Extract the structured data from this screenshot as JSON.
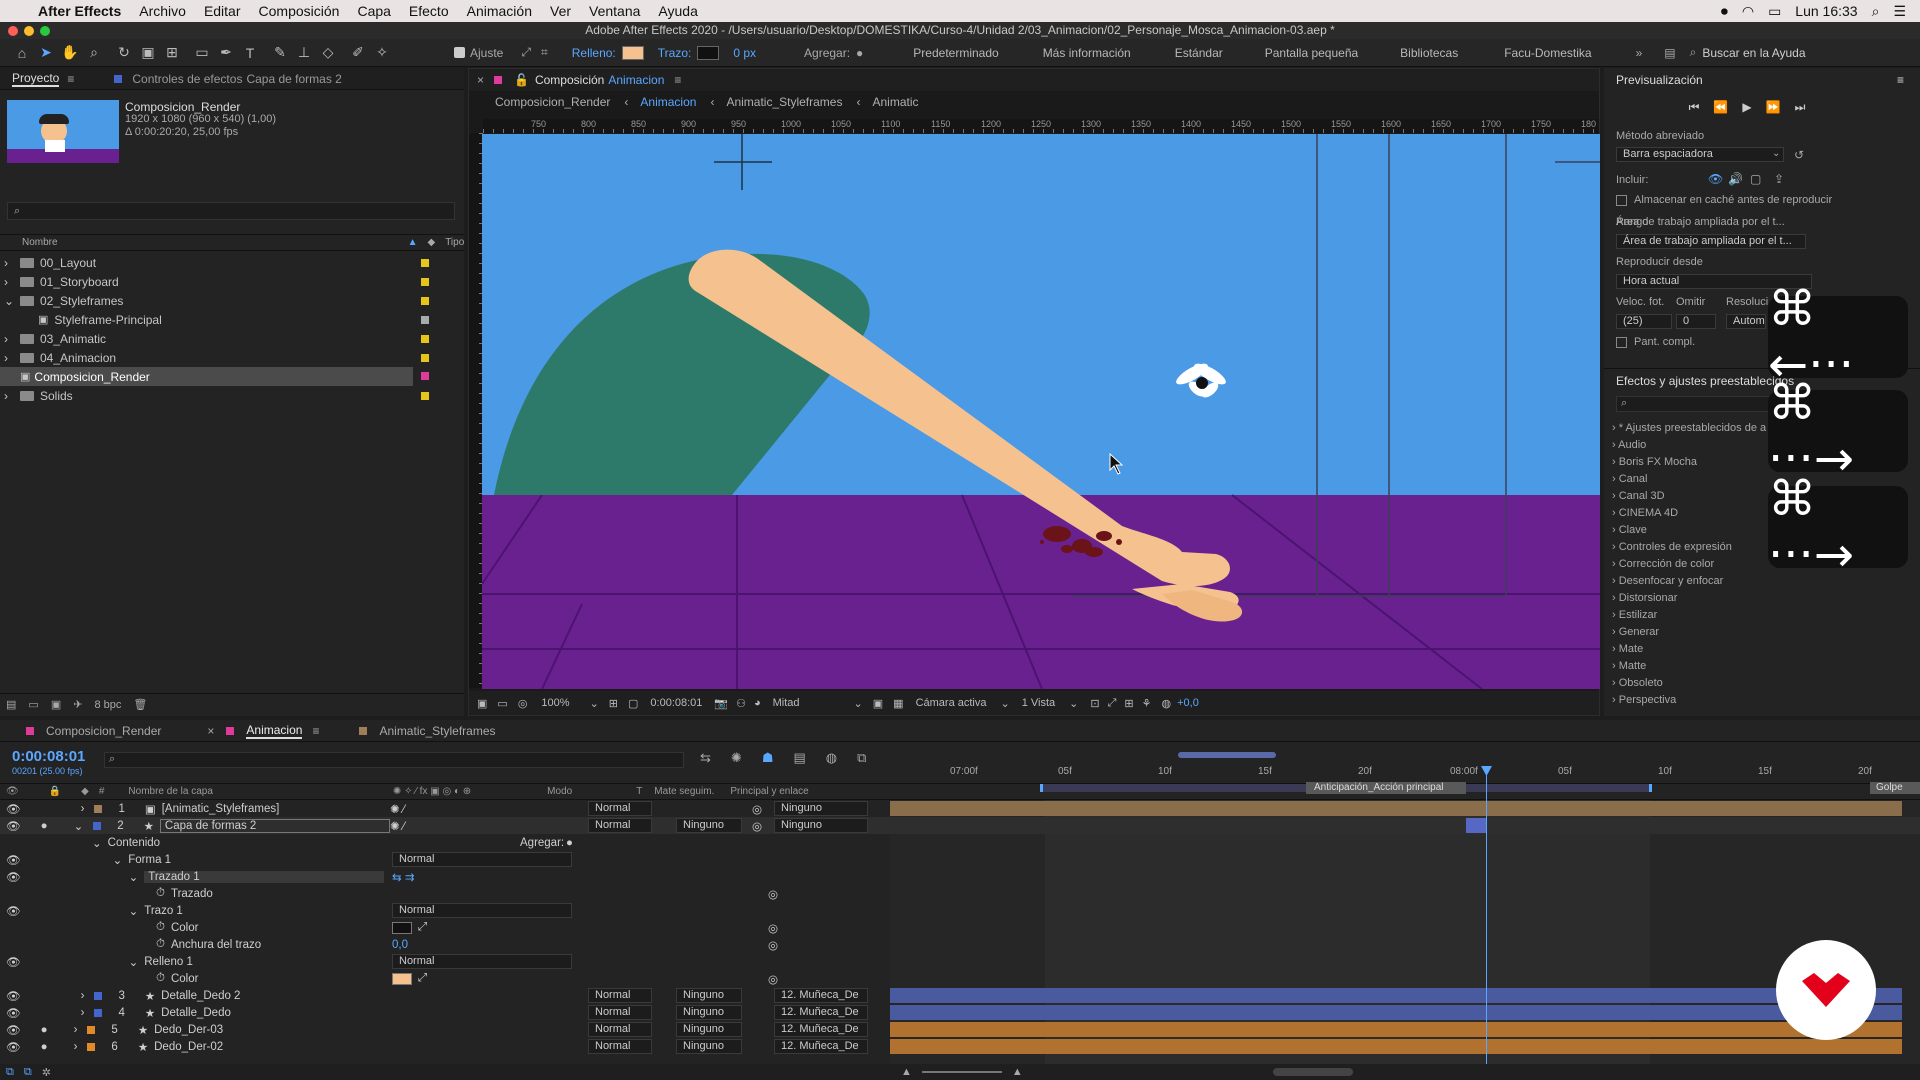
{
  "menubar": {
    "app": "After Effects",
    "items": [
      "Archivo",
      "Editar",
      "Composición",
      "Capa",
      "Efecto",
      "Animación",
      "Ver",
      "Ventana",
      "Ayuda"
    ],
    "clock": "Lun 16:33"
  },
  "window_title": "Adobe After Effects 2020 - /Users/usuario/Desktop/DOMESTIKA/Curso-4/Unidad 2/03_Animacion/02_Personaje_Mosca_Animacion-03.aep *",
  "toolbar": {
    "ajuste": "Ajuste",
    "relleno": "Relleno:",
    "trazo": "Trazo:",
    "trazo_px": "0 px",
    "agregar": "Agregar:",
    "workspaces": [
      "Predeterminado",
      "Más información",
      "Estándar",
      "Pantalla pequeña",
      "Bibliotecas",
      "Facu-Domestika"
    ],
    "help_placeholder": "Buscar en la Ayuda"
  },
  "project": {
    "tab": "Proyecto",
    "effects_tab": "Controles de efectos",
    "effects_layer": "Capa de formas 2",
    "comp_name": "Composicion_Render",
    "comp_info1": "1920 x 1080  (960 x 540) (1,00)",
    "comp_info2": "Δ 0:00:20:20, 25,00 fps",
    "col_name": "Nombre",
    "col_type": "Tipo",
    "bpc": "8 bpc",
    "items": [
      {
        "name": "00_Layout",
        "kind": "folder"
      },
      {
        "name": "01_Storyboard",
        "kind": "folder"
      },
      {
        "name": "02_Styleframes",
        "kind": "folder"
      },
      {
        "name": "Styleframe-Principal",
        "kind": "comp"
      },
      {
        "name": "03_Animatic",
        "kind": "folder"
      },
      {
        "name": "04_Animacion",
        "kind": "folder"
      },
      {
        "name": "Composicion_Render",
        "kind": "comp"
      },
      {
        "name": "Solids",
        "kind": "folder"
      }
    ]
  },
  "viewer": {
    "tab_prefix": "Composición",
    "tab_name": "Animacion",
    "breadcrumbs": [
      "Composicion_Render",
      "Animacion",
      "Animatic_Styleframes",
      "Animatic"
    ],
    "ruler": [
      "750",
      "800",
      "850",
      "900",
      "950",
      "1000",
      "1050",
      "1100",
      "1150",
      "1200",
      "1250",
      "1300",
      "1350",
      "1400",
      "1450",
      "1500",
      "1550",
      "1600",
      "1650",
      "1700",
      "1750",
      "180"
    ],
    "zoom": "100%",
    "time": "0:00:08:01",
    "resolution": "Mitad",
    "camera": "Cámara activa",
    "views": "1 Vista",
    "exposure": "+0,0"
  },
  "preview": {
    "title": "Previsualización",
    "metodo_label": "Método abreviado",
    "metodo": "Barra espaciadora",
    "incluir": "Incluir:",
    "cache": "Almacenar en caché antes de reproducir",
    "rango_label": "Rango",
    "rango": "Área de trabajo ampliada por el t...",
    "reproducir_label": "Reproducir desde",
    "reproducir": "Hora actual",
    "veloc": "Veloc. fot.",
    "omitir": "Omitir",
    "resol": "Resoluci",
    "fps": "(25)",
    "skip": "0",
    "auto": "Autom",
    "pant": "Pant. compl."
  },
  "effects": {
    "title": "Efectos y ajustes preestablecidos",
    "items": [
      "* Ajustes preestablecidos de a",
      "Audio",
      "Boris FX Mocha",
      "Canal",
      "Canal 3D",
      "CINEMA 4D",
      "Clave",
      "Controles de expresión",
      "Corrección de color",
      "Desenfocar y enfocar",
      "Distorsionar",
      "Estilizar",
      "Generar",
      "Mate",
      "Matte",
      "Obsoleto",
      "Perspectiva"
    ]
  },
  "timeline": {
    "tabs": [
      "Composicion_Render",
      "Animacion",
      "Animatic_Styleframes"
    ],
    "timecode": "0:00:08:01",
    "frames": "00201 (25.00 fps)",
    "cols": {
      "name": "Nombre de la capa",
      "mode": "Modo",
      "t": "T",
      "mate": "Mate seguim.",
      "parent": "Principal y enlace"
    },
    "ruler": [
      "07:00f",
      "05f",
      "10f",
      "15f",
      "20f",
      "08:00f",
      "05f",
      "10f",
      "15f",
      "20f"
    ],
    "marker": "Anticipación_Acción principal",
    "marker2": "Golpe",
    "layers": [
      {
        "num": "1",
        "name": "[Animatic_Styleframes]",
        "mode": "Normal",
        "mate": "",
        "parent": "Ninguno",
        "color": "#a07f58"
      },
      {
        "num": "2",
        "name": "Capa de formas 2",
        "mode": "Normal",
        "mate": "Ninguno",
        "parent": "Ninguno",
        "color": "#4466cc"
      }
    ],
    "props": {
      "contenido": "Contenido",
      "agregar": "Agregar:",
      "forma": "Forma 1",
      "forma_mode": "Normal",
      "trazado1": "Trazado 1",
      "trazado": "Trazado",
      "trazo": "Trazo 1",
      "trazo_mode": "Normal",
      "color": "Color",
      "anchura": "Anchura del trazo",
      "anchura_val": "0,0",
      "relleno": "Relleno 1",
      "relleno_mode": "Normal",
      "color2": "Color"
    },
    "layers2": [
      {
        "num": "3",
        "name": "Detalle_Dedo 2",
        "mode": "Normal",
        "mate": "Ninguno",
        "parent": "12. Muñeca_De",
        "color": "#4466cc"
      },
      {
        "num": "4",
        "name": "Detalle_Dedo",
        "mode": "Normal",
        "mate": "Ninguno",
        "parent": "12. Muñeca_De",
        "color": "#4466cc"
      },
      {
        "num": "5",
        "name": "Dedo_Der-03",
        "mode": "Normal",
        "mate": "Ninguno",
        "parent": "12. Muñeca_De",
        "color": "#e08a2a"
      },
      {
        "num": "6",
        "name": "Dedo_Der-02",
        "mode": "Normal",
        "mate": "Ninguno",
        "parent": "12. Muñeca_De",
        "color": "#e08a2a"
      }
    ]
  },
  "shortcuts": [
    "⌘ ←···",
    "⌘ ···→",
    "⌘ ···→"
  ]
}
